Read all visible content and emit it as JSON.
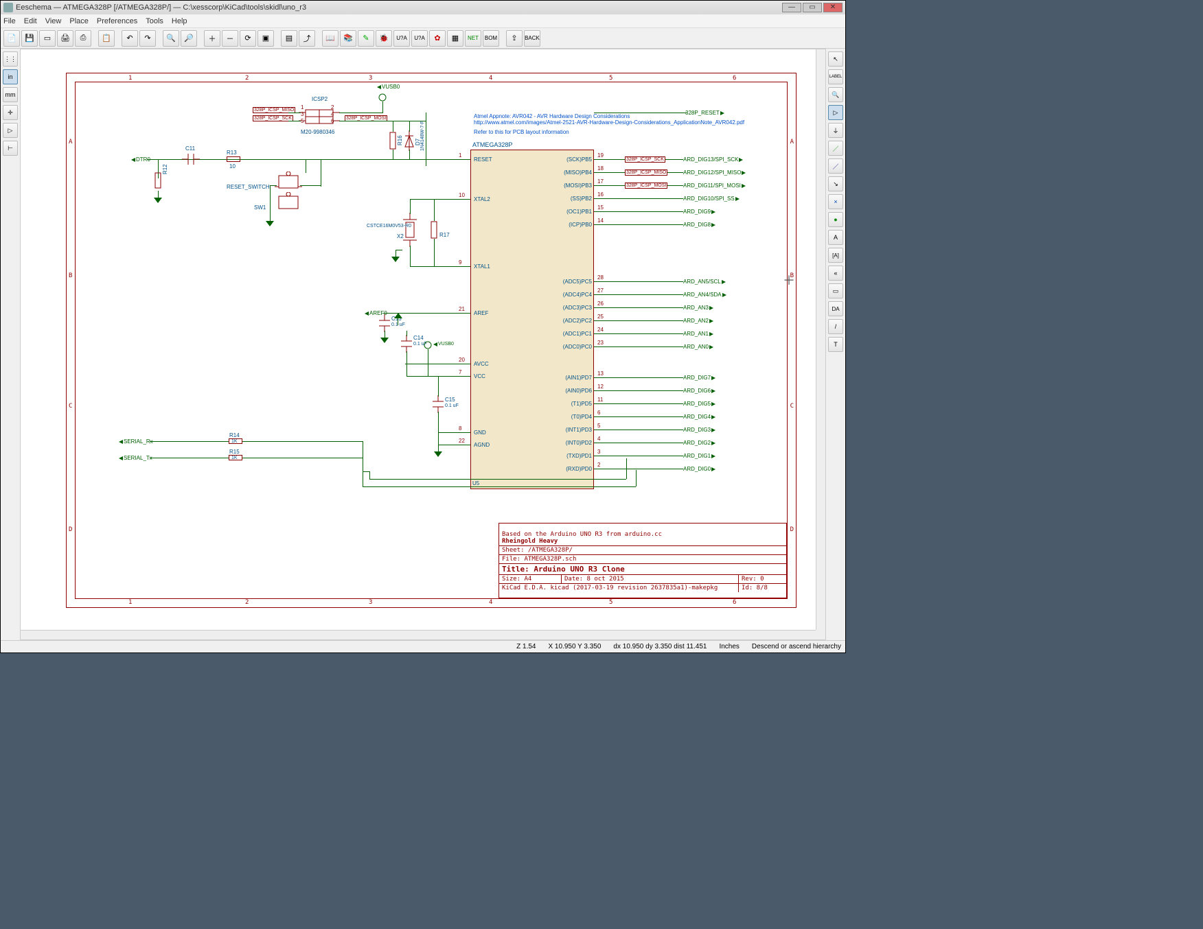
{
  "window": {
    "title": "Eeschema — ATMEGA328P [/ATMEGA328P/] — C:\\xesscorp\\KiCad\\tools\\skidl\\uno_r3"
  },
  "menu": [
    "File",
    "Edit",
    "View",
    "Place",
    "Preferences",
    "Tools",
    "Help"
  ],
  "left_toolbar": [
    {
      "name": "grid-icon",
      "glyph": "⋮⋮"
    },
    {
      "name": "in-unit-icon",
      "glyph": "in"
    },
    {
      "name": "mm-unit-icon",
      "glyph": "mm"
    },
    {
      "name": "cursor-shape-icon",
      "glyph": "✛"
    },
    {
      "name": "hidden-pins-icon",
      "glyph": "▷"
    },
    {
      "name": "bus-dir-icon",
      "glyph": "⊢"
    }
  ],
  "right_toolbar": [
    {
      "name": "select-icon",
      "glyph": "↖"
    },
    {
      "name": "highlight-net-icon",
      "glyph": "LABEL"
    },
    {
      "name": "zoom-area-icon",
      "glyph": "🔍"
    },
    {
      "name": "place-symbol-icon",
      "glyph": "▷"
    },
    {
      "name": "place-power-icon",
      "glyph": "⏚"
    },
    {
      "name": "place-wire-icon",
      "glyph": "／"
    },
    {
      "name": "place-bus-icon",
      "glyph": "／"
    },
    {
      "name": "bus-entry-icon",
      "glyph": "↘"
    },
    {
      "name": "no-connect-icon",
      "glyph": "×"
    },
    {
      "name": "junction-icon",
      "glyph": "●"
    },
    {
      "name": "net-label-icon",
      "glyph": "A"
    },
    {
      "name": "global-label-icon",
      "glyph": "[A]"
    },
    {
      "name": "hier-label-icon",
      "glyph": "«"
    },
    {
      "name": "hier-sheet-icon",
      "glyph": "▭"
    },
    {
      "name": "hier-pin-icon",
      "glyph": "DA"
    },
    {
      "name": "graphic-line-icon",
      "glyph": "/"
    },
    {
      "name": "text-icon",
      "glyph": "T"
    }
  ],
  "frame": {
    "cols": [
      "1",
      "2",
      "3",
      "4",
      "5",
      "6"
    ],
    "rows": [
      "A",
      "B",
      "C",
      "D"
    ]
  },
  "notes": {
    "line1": "Atmel Appnote: AVR042 - AVR Hardware Design Considerations",
    "line2": "http://www.atmel.com/images/Atmel-2521-AVR-Hardware-Design-Considerations_ApplicationNote_AVR042.pdf",
    "line3": "Refer to this for PCB layout information"
  },
  "ic": {
    "ref": "U5",
    "value": "ATMEGA328P",
    "footprint": "ATMEGA328P",
    "left_pins": [
      {
        "num": "1",
        "name": "RESET"
      },
      {
        "num": "10",
        "name": "XTAL2"
      },
      {
        "num": "9",
        "name": "XTAL1"
      },
      {
        "num": "21",
        "name": "AREF"
      },
      {
        "num": "20",
        "name": "AVCC"
      },
      {
        "num": "7",
        "name": "VCC"
      },
      {
        "num": "8",
        "name": "GND"
      },
      {
        "num": "22",
        "name": "AGND"
      }
    ],
    "right_pins": [
      {
        "num": "19",
        "name": "(SCK)PB5",
        "net": "ARD_DIG13/SPI_SCK",
        "gl": "328P_ICSP_SCK"
      },
      {
        "num": "18",
        "name": "(MISO)PB4",
        "net": "ARD_DIG12/SPI_MISO",
        "gl": "328P_ICSP_MISO"
      },
      {
        "num": "17",
        "name": "(MOSI)PB3",
        "net": "ARD_DIG11/SPI_MOSI",
        "gl": "328P_ICSP_MOSI"
      },
      {
        "num": "16",
        "name": "(SS)PB2",
        "net": "ARD_DIG10/SPI_SS"
      },
      {
        "num": "15",
        "name": "(OC1)PB1",
        "net": "ARD_DIG9"
      },
      {
        "num": "14",
        "name": "(ICP)PB0",
        "net": "ARD_DIG8"
      },
      {
        "num": "28",
        "name": "(ADC5)PC5",
        "net": "ARD_AN5/SCL"
      },
      {
        "num": "27",
        "name": "(ADC4)PC4",
        "net": "ARD_AN4/SDA"
      },
      {
        "num": "26",
        "name": "(ADC3)PC3",
        "net": "ARD_AN3"
      },
      {
        "num": "25",
        "name": "(ADC2)PC2",
        "net": "ARD_AN2"
      },
      {
        "num": "24",
        "name": "(ADC1)PC1",
        "net": "ARD_AN1"
      },
      {
        "num": "23",
        "name": "(ADC0)PC0",
        "net": "ARD_AN0"
      },
      {
        "num": "13",
        "name": "(AIN1)PD7",
        "net": "ARD_DIG7"
      },
      {
        "num": "12",
        "name": "(AIN0)PD6",
        "net": "ARD_DIG6"
      },
      {
        "num": "11",
        "name": "(T1)PD5",
        "net": "ARD_DIG5"
      },
      {
        "num": "6",
        "name": "(T0)PD4",
        "net": "ARD_DIG4"
      },
      {
        "num": "5",
        "name": "(INT1)PD3",
        "net": "ARD_DIG3"
      },
      {
        "num": "4",
        "name": "(INT0)PD2",
        "net": "ARD_DIG2"
      },
      {
        "num": "3",
        "name": "(TXD)PD1",
        "net": "ARD_DIG1"
      },
      {
        "num": "2",
        "name": "(RXD)PD0",
        "net": "ARD_DIG0"
      }
    ]
  },
  "icsp": {
    "ref": "ICSP2",
    "footprint": "M20-9980346",
    "gl_miso": "328P_ICSP_MISO",
    "gl_sck": "328P_ICSP_SCK",
    "gl_mosi": "328P_ICSP_MOSI"
  },
  "reset": {
    "hl": "328P_RESET",
    "gl": "328P_RESET"
  },
  "left_nets": {
    "dtr": "DTR0",
    "aref": "AREF0",
    "rx": "SERIAL_Rx",
    "tx": "SERIAL_Tx",
    "reset_switch": "RESET_SWITCH",
    "sw": "SW1"
  },
  "parts": {
    "c11": {
      "ref": "C11",
      "val": ""
    },
    "r13": {
      "ref": "R13",
      "val": "10"
    },
    "r14": {
      "ref": "R14",
      "val": "1K"
    },
    "r15": {
      "ref": "R15",
      "val": "1K"
    },
    "r16": {
      "ref": "R16",
      "val": ""
    },
    "r17": {
      "ref": "R17",
      "val": ""
    },
    "r12": {
      "ref": "R12",
      "val": ""
    },
    "d7": {
      "ref": "D7",
      "val": "1N4148W-7-F"
    },
    "x2": {
      "ref": "X2",
      "val": "CSTCE16M0V53-R0"
    },
    "c14": {
      "ref": "C14",
      "val": "0.1 uF"
    },
    "c15": {
      "ref": "C15",
      "val": "0.1 uF"
    },
    "c13": {
      "ref": "C13",
      "val": "0.1 uF"
    }
  },
  "pwr": {
    "vusb": "VUSB0",
    "vusb2": "VUSB0"
  },
  "titleblock": {
    "note1": "Based on the Arduino UNO R3 from arduino.cc",
    "note2": "Rheingold Heavy",
    "sheet": "Sheet: /ATMEGA328P/",
    "file": "File: ATMEGA328P.sch",
    "title": "Title: Arduino UNO R3 Clone",
    "size": "Size: A4",
    "date": "Date: 8 oct 2015",
    "rev": "Rev: 0",
    "kicad": "KiCad E.D.A.  kicad (2017-03-19 revision 2637835a1)-makepkg",
    "id": "Id: 8/8"
  },
  "status": {
    "zoom": "Z 1.54",
    "xy": "X 10.950  Y 3.350",
    "dxy": "dx 10.950  dy 3.350  dist 11.451",
    "units": "Inches",
    "hint": "Descend or ascend hierarchy"
  }
}
